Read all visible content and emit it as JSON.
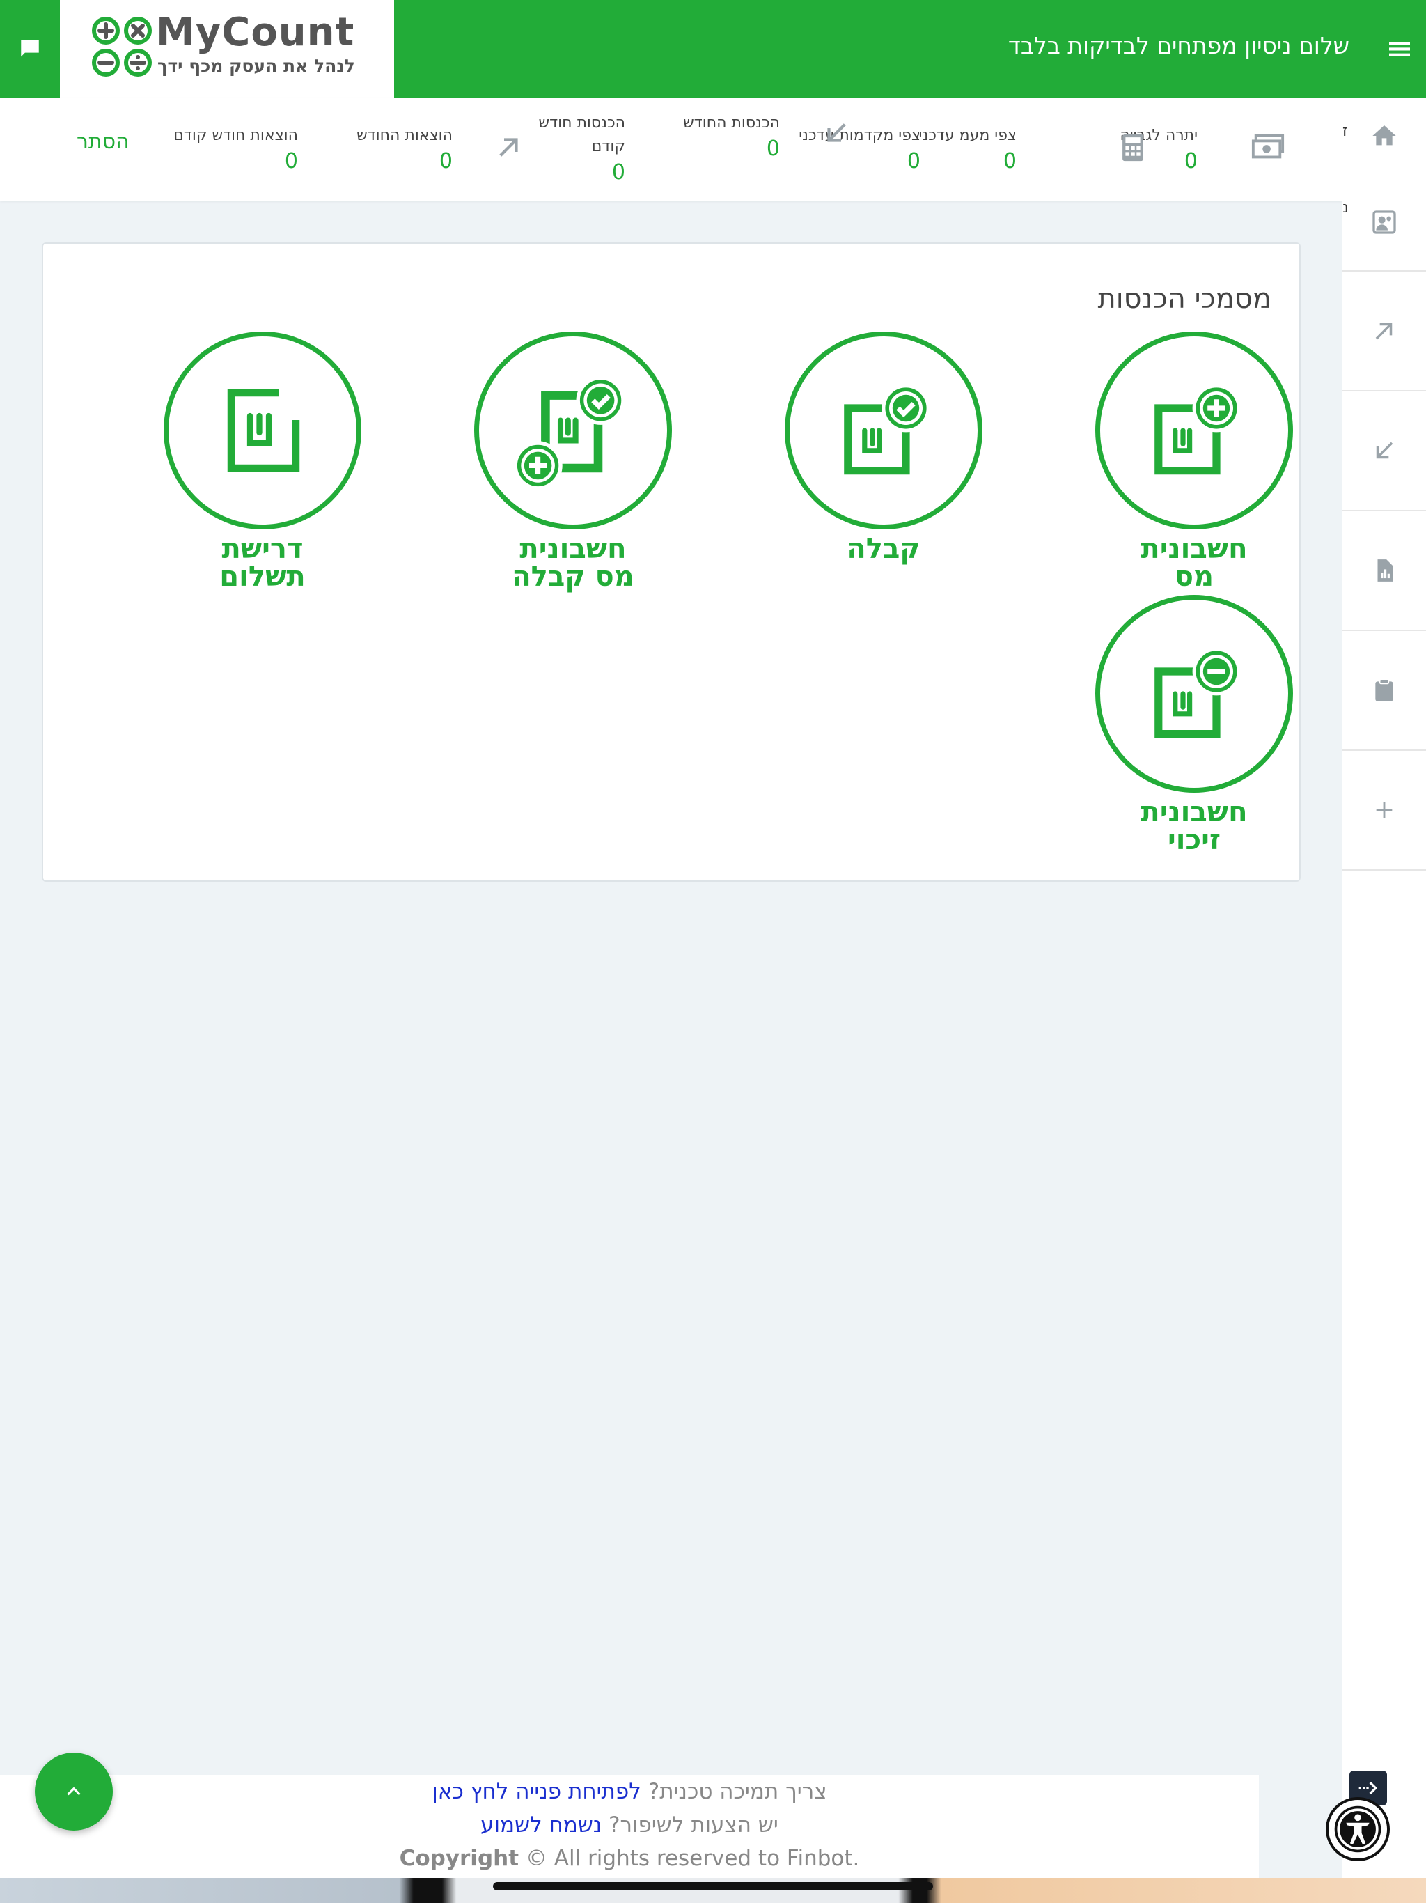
{
  "header": {
    "logo_name": "MyCount",
    "logo_tagline": "לנהל את העסק מכף ידך",
    "greeting": "שלום ניסיון מפתחים לבדיקות בלבד",
    "brand_color": "#22ac38"
  },
  "sidebar": {
    "clipped_labels": [
      "ז",
      "נ"
    ],
    "items": [
      "home-icon",
      "people-icon",
      "arrow-up-right-icon",
      "arrow-down-left-icon",
      "report-icon",
      "clipboard-icon",
      "plus-icon"
    ]
  },
  "stats": {
    "items": [
      {
        "label": "יתרה לגבייה",
        "value": "0"
      },
      {
        "label": "צפי מעמ עדכני",
        "value": "0"
      },
      {
        "label": "צפי מקדמות עדכני",
        "value": "0"
      },
      {
        "label": "הכנסות החודש",
        "value": "0"
      },
      {
        "label": "הכנסות חודש קודם",
        "value": "0"
      },
      {
        "label": "הוצאות החודש",
        "value": "0"
      },
      {
        "label": "הוצאות חודש קודם",
        "value": "0"
      }
    ],
    "hide_label": "הסתר"
  },
  "card": {
    "title": "מסמכי הכנסות",
    "docs": [
      {
        "label": "חשבונית\nמס",
        "icon": "invoice-plus-icon"
      },
      {
        "label": "קבלה",
        "icon": "receipt-check-icon"
      },
      {
        "label": "חשבונית\nמס קבלה",
        "icon": "invoice-receipt-icon"
      },
      {
        "label": "דרישת\nתשלום",
        "icon": "payment-request-icon"
      },
      {
        "label": "חשבונית\nזיכוי",
        "icon": "credit-note-icon"
      }
    ]
  },
  "footer": {
    "support_q": "צריך תמיכה טכנית?",
    "support_link": "לפתיחת פנייה לחץ כאן",
    "improve_q": "יש הצעות לשיפור?",
    "improve_link": "נשמח לשמוע",
    "copyright_bold": "Copyright",
    "copyright_rest": "© All rights reserved to Finbot."
  }
}
